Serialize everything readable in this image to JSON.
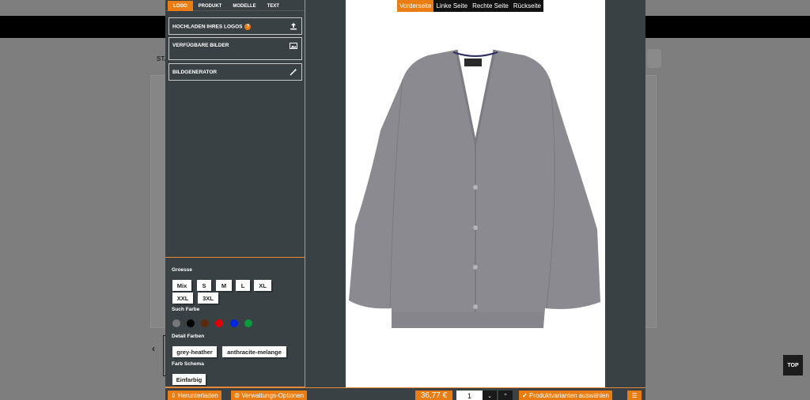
{
  "background": {
    "label": "STA",
    "top_button": "TOP"
  },
  "tabs": [
    {
      "label": "LOGO",
      "active": true
    },
    {
      "label": "PRODUKT",
      "active": false
    },
    {
      "label": "MODELLE",
      "active": false
    },
    {
      "label": "TEXT",
      "active": false
    }
  ],
  "panel_buttons": {
    "upload": "HOCHLADEN IHRES LOGOS",
    "images": "VERFÜGBARE BILDER",
    "generator": "BILDGENERATOR"
  },
  "options": {
    "size_title": "Groesse",
    "sizes": [
      "Mix",
      "S",
      "M",
      "L",
      "XL",
      "XXL",
      "3XL"
    ],
    "color_title": "Such Farbe",
    "colors": [
      "#777777",
      "#000000",
      "#5a2a0a",
      "#e00000",
      "#0026e0",
      "#0a9a3c"
    ],
    "detail_title": "Detail Farben",
    "detail_colors": [
      "grey-heather",
      "anthracite-melange"
    ],
    "scheme_title": "Farb Schema",
    "scheme": "Einfarbig"
  },
  "views": [
    {
      "label": "Vorderseite",
      "active": true
    },
    {
      "label": "Linke Seite",
      "active": false
    },
    {
      "label": "Rechte Seite",
      "active": false
    },
    {
      "label": "Rückseite",
      "active": false
    }
  ],
  "bottom": {
    "download": "Herunterladen",
    "admin": "Verwaltungs-Optionen",
    "price": "36,77 €",
    "quantity": "1",
    "variants": "Produktvarianten auswählen"
  },
  "colors": {
    "accent": "#e97d14",
    "panel": "#3a4145",
    "garment": "#8a8a90"
  }
}
